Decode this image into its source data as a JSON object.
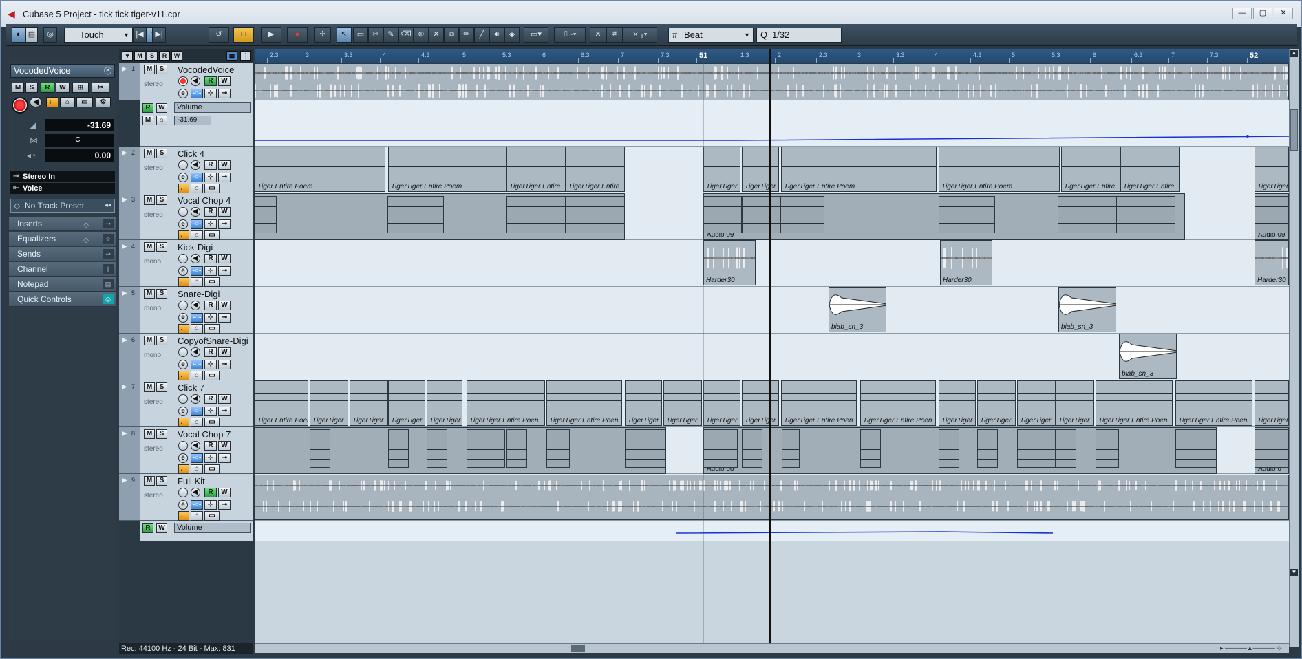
{
  "window": {
    "title": "Cubase 5 Project - tick tick tiger-v11.cpr",
    "controls": {
      "minimize": "—",
      "maximize": "▢",
      "close": "✕"
    }
  },
  "toolbar": {
    "automation_mode": "Touch",
    "snap_type": "Beat",
    "quantize": "1/32"
  },
  "inspector": {
    "track_name": "VocodedVoice",
    "buttons": {
      "mute": "M",
      "solo": "S",
      "read": "R",
      "write": "W"
    },
    "volume": "-31.69",
    "pan": "C",
    "delay": "0.00",
    "input": "Stereo In",
    "output": "Voice",
    "preset": "No Track Preset",
    "sections": [
      "Inserts",
      "Equalizers",
      "Sends",
      "Channel",
      "Notepad",
      "Quick Controls"
    ]
  },
  "tracklist": {
    "header_buttons": [
      "M",
      "S",
      "R",
      "W"
    ],
    "tracks": [
      {
        "num": "1",
        "name": "VocodedVoice",
        "type": "stereo"
      },
      {
        "num": "2",
        "name": "Click 4",
        "type": "stereo"
      },
      {
        "num": "3",
        "name": "Vocal Chop 4",
        "type": "stereo"
      },
      {
        "num": "4",
        "name": "Kick-Digi",
        "type": "mono"
      },
      {
        "num": "5",
        "name": "Snare-Digi",
        "type": "mono"
      },
      {
        "num": "6",
        "name": "CopyofSnare-Digi",
        "type": "mono"
      },
      {
        "num": "7",
        "name": "Click 7",
        "type": "stereo"
      },
      {
        "num": "8",
        "name": "Vocal Chop 7",
        "type": "stereo"
      },
      {
        "num": "9",
        "name": "Full Kit",
        "type": "stereo"
      }
    ],
    "automation": [
      {
        "param": "Volume",
        "value": "-31.69"
      },
      {
        "param": "Volume",
        "value": ""
      }
    ]
  },
  "ruler": {
    "labels": [
      "2.3",
      "3",
      "3.3",
      "4",
      "4.3",
      "5",
      "5.3",
      "6",
      "6.3",
      "7",
      "7.3",
      "51",
      "1.3",
      "2",
      "2.3",
      "3",
      "3.3",
      "4",
      "4.3",
      "5",
      "5.3",
      "6",
      "6.3",
      "7",
      "7.3",
      "52"
    ]
  },
  "events": {
    "click4": [
      "Tiger Entire Poem",
      "TigerTiger Entire Poem",
      "TigerTiger Entire",
      "TigerTiger Entire",
      "TigerTiger",
      "TigerTiger",
      "TigerTiger Entire Poem",
      "TigerTiger Entire Poem",
      "TigerTiger Entire",
      "TigerTiger Entire",
      "TigerTiger"
    ],
    "vocalchop4_part": "Audio 09",
    "vocalchop4_part2": "Audio 09",
    "kick": [
      "Harder30",
      "Harder30",
      "Harder30"
    ],
    "snare": [
      "biab_sn_3",
      "biab_sn_3"
    ],
    "copysnare": [
      "biab_sn_3"
    ],
    "click7": [
      "Tiger Entire Poen",
      "TigerTiger",
      "TigerTiger",
      "TigerTiger",
      "TigerTiger",
      "TigerTiger Entire Poen",
      "TigerTiger Entire Poen",
      "TigerTiger",
      "TigerTiger",
      "TigerTiger",
      "TigerTiger",
      "TigerTiger Entire Poen",
      "TigerTiger Entire Poen",
      "TigerTiger",
      "TigerTiger",
      "TigerTiger",
      "TigerTiger",
      "TigerTiger Entire Poen",
      "TigerTiger Entire Poen",
      "TigerTiger"
    ],
    "vocalchop7_part": "Audio 08",
    "vocalchop7_part2": "Audio 0"
  },
  "status": {
    "text": "Rec: 44100 Hz - 24 Bit - Max: 831"
  }
}
